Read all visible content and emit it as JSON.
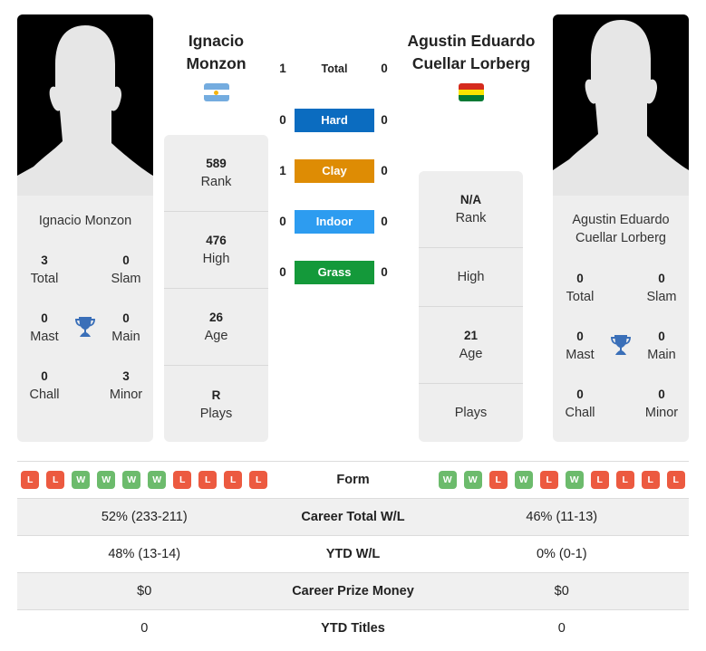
{
  "player1": {
    "name_line1": "Ignacio",
    "name_line2": "Monzon",
    "card_name": "Ignacio Monzon",
    "country": "Argentina",
    "flag_colors": [
      "#74acdf",
      "#ffffff",
      "#74acdf"
    ],
    "flag_sun_color": "#f6b40e",
    "titles": {
      "total": {
        "value": "3",
        "label": "Total"
      },
      "slam": {
        "value": "0",
        "label": "Slam"
      },
      "mast": {
        "value": "0",
        "label": "Mast"
      },
      "main": {
        "value": "0",
        "label": "Main"
      },
      "chall": {
        "value": "0",
        "label": "Chall"
      },
      "minor": {
        "value": "3",
        "label": "Minor"
      }
    },
    "stats": [
      {
        "value": "589",
        "label": "Rank"
      },
      {
        "value": "476",
        "label": "High"
      },
      {
        "value": "26",
        "label": "Age"
      },
      {
        "value": "R",
        "label": "Plays"
      }
    ],
    "form": [
      "L",
      "L",
      "W",
      "W",
      "W",
      "W",
      "L",
      "L",
      "L",
      "L"
    ]
  },
  "player2": {
    "name_line1": "Agustin Eduardo",
    "name_line2": "Cuellar Lorberg",
    "card_name_line1": "Agustin Eduardo",
    "card_name_line2": "Cuellar Lorberg",
    "country": "Bolivia",
    "flag_colors": [
      "#d52b1e",
      "#f9e300",
      "#007934"
    ],
    "titles": {
      "total": {
        "value": "0",
        "label": "Total"
      },
      "slam": {
        "value": "0",
        "label": "Slam"
      },
      "mast": {
        "value": "0",
        "label": "Mast"
      },
      "main": {
        "value": "0",
        "label": "Main"
      },
      "chall": {
        "value": "0",
        "label": "Chall"
      },
      "minor": {
        "value": "0",
        "label": "Minor"
      }
    },
    "stats": [
      {
        "value": "N/A",
        "label": "Rank"
      },
      {
        "value": "",
        "label": "High"
      },
      {
        "value": "21",
        "label": "Age"
      },
      {
        "value": "",
        "label": "Plays"
      }
    ],
    "form": [
      "W",
      "W",
      "L",
      "W",
      "L",
      "W",
      "L",
      "L",
      "L",
      "L"
    ]
  },
  "h2h": [
    {
      "surface": "Total",
      "p1": "1",
      "p2": "0",
      "color": ""
    },
    {
      "surface": "Hard",
      "p1": "0",
      "p2": "0",
      "color": "#0b6cc0"
    },
    {
      "surface": "Clay",
      "p1": "1",
      "p2": "0",
      "color": "#de8c04"
    },
    {
      "surface": "Indoor",
      "p1": "0",
      "p2": "0",
      "color": "#2d9cf0"
    },
    {
      "surface": "Grass",
      "p1": "0",
      "p2": "0",
      "color": "#14993a"
    }
  ],
  "comparison": {
    "form_label": "Form",
    "rows": [
      {
        "label": "Career Total W/L",
        "p1": "52% (233-211)",
        "p2": "46% (11-13)"
      },
      {
        "label": "YTD W/L",
        "p1": "48% (13-14)",
        "p2": "0% (0-1)"
      },
      {
        "label": "Career Prize Money",
        "p1": "$0",
        "p2": "$0"
      },
      {
        "label": "YTD Titles",
        "p1": "0",
        "p2": "0"
      }
    ]
  },
  "colors": {
    "trophy": "#3a6fb8",
    "win": "#6cbb6c",
    "loss": "#ec5a40"
  }
}
